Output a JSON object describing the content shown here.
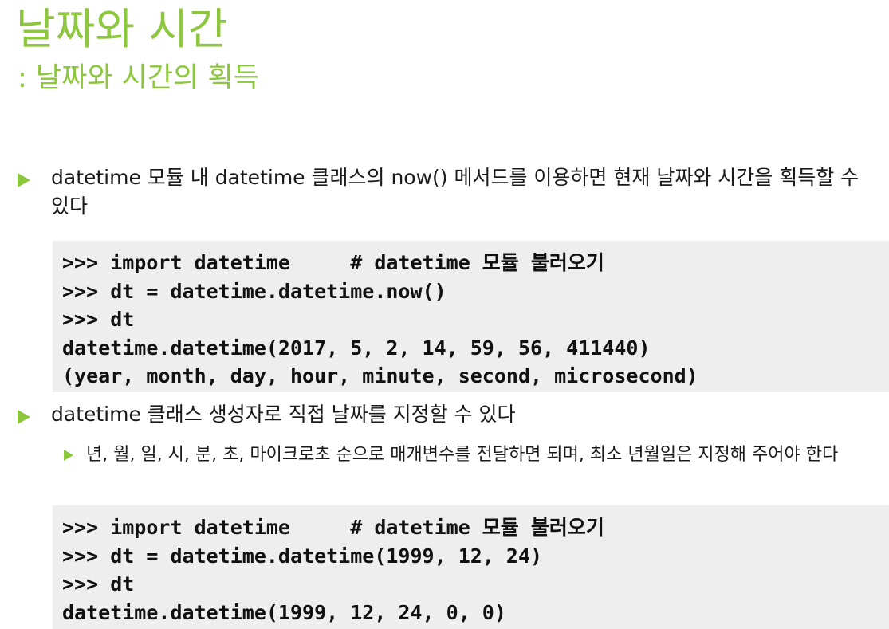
{
  "slide": {
    "title": "날짜와 시간",
    "subtitle": ": 날짜와 시간의 획득",
    "accent_color": "#8dc63f",
    "bullets": [
      {
        "text": "datetime 모듈 내 datetime 클래스의 now() 메서드를 이용하면 현재 날짜와 시간을 획득할 수 있다"
      },
      {
        "text": "datetime 클래스 생성자로 직접 날짜를 지정할 수 있다"
      }
    ],
    "sub_bullets": [
      {
        "text": "년, 월, 일, 시, 분, 초, 마이크로초 순으로 매개변수를 전달하면 되며, 최소 년월일은 지정해 주어야 한다"
      }
    ],
    "code_blocks": [
      {
        "lines": [
          ">>> import datetime     # datetime 모듈 불러오기",
          ">>> dt = datetime.datetime.now()",
          ">>> dt",
          "datetime.datetime(2017, 5, 2, 14, 59, 56, 411440)",
          "(year, month, day, hour, minute, second, microsecond)"
        ]
      },
      {
        "lines": [
          ">>> import datetime     # datetime 모듈 불러오기",
          ">>> dt = datetime.datetime(1999, 12, 24)",
          ">>> dt",
          "datetime.datetime(1999, 12, 24, 0, 0)"
        ]
      }
    ]
  }
}
